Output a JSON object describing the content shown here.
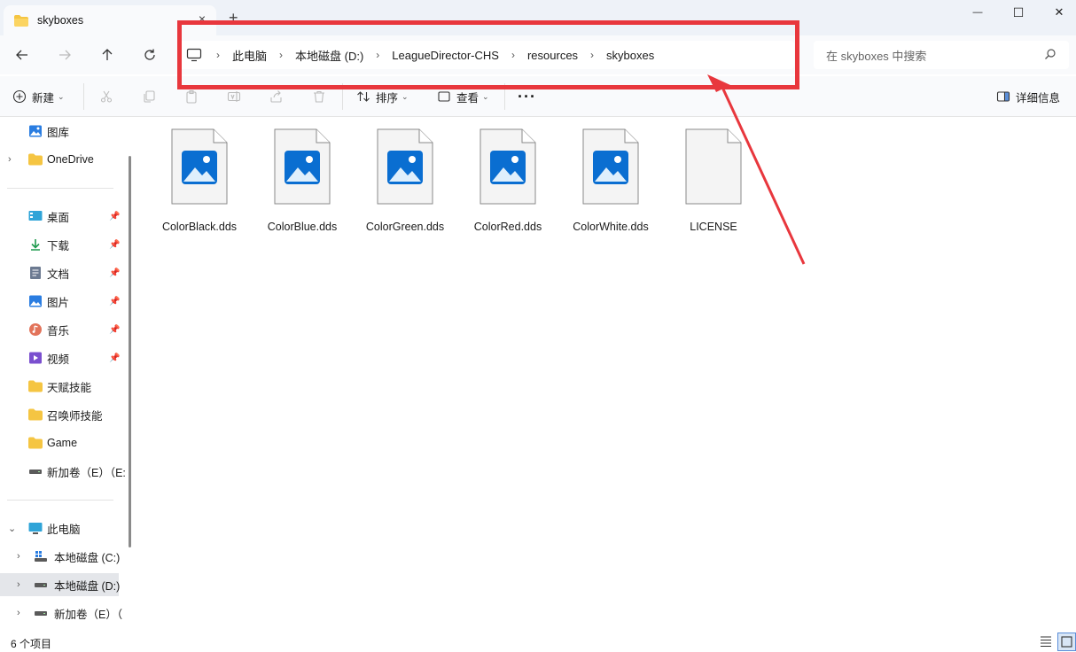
{
  "window": {
    "tab_title": "skyboxes",
    "tab_close": "×",
    "new_tab": "+",
    "controls": {
      "minimize": "—",
      "maximize": "☐",
      "close": "✕"
    }
  },
  "address_bar": {
    "breadcrumbs": [
      "此电脑",
      "本地磁盘 (D:)",
      "LeagueDirector-CHS",
      "resources",
      "skyboxes"
    ],
    "separator": "›"
  },
  "search": {
    "placeholder": "在 skyboxes 中搜索"
  },
  "command_bar": {
    "new_label": "新建",
    "sort_label": "排序",
    "view_label": "查看",
    "more_label": "···",
    "details_label": "详细信息"
  },
  "sidebar": {
    "gallery": "图库",
    "onedrive": "OneDrive",
    "quick_access": [
      {
        "label": "桌面",
        "icon": "desktop-icon",
        "pinned": true
      },
      {
        "label": "下载",
        "icon": "download-icon",
        "pinned": true
      },
      {
        "label": "文档",
        "icon": "document-icon",
        "pinned": true
      },
      {
        "label": "图片",
        "icon": "pictures-icon",
        "pinned": true
      },
      {
        "label": "音乐",
        "icon": "music-icon",
        "pinned": true
      },
      {
        "label": "视频",
        "icon": "video-icon",
        "pinned": true
      },
      {
        "label": "天赋技能",
        "icon": "folder-icon",
        "pinned": false
      },
      {
        "label": "召唤师技能",
        "icon": "folder-icon",
        "pinned": false
      },
      {
        "label": "Game",
        "icon": "folder-icon",
        "pinned": false
      },
      {
        "label": "新加卷（E）（E:",
        "icon": "drive-icon",
        "pinned": false
      }
    ],
    "this_pc": "此电脑",
    "drives": [
      {
        "label": "本地磁盘 (C:)",
        "icon": "windows-drive-icon",
        "selected": false
      },
      {
        "label": "本地磁盘 (D:)",
        "icon": "drive-icon",
        "selected": true
      },
      {
        "label": "新加卷（E）（",
        "icon": "drive-icon",
        "selected": false
      }
    ]
  },
  "files": [
    {
      "name": "ColorBlack.dds",
      "type": "image"
    },
    {
      "name": "ColorBlue.dds",
      "type": "image"
    },
    {
      "name": "ColorGreen.dds",
      "type": "image"
    },
    {
      "name": "ColorRed.dds",
      "type": "image"
    },
    {
      "name": "ColorWhite.dds",
      "type": "image"
    },
    {
      "name": "LICENSE",
      "type": "generic"
    }
  ],
  "status": {
    "item_count": "6 个项目"
  },
  "colors": {
    "annotation_red": "#e8373d",
    "accent_blue": "#0a6ed1",
    "folder_yellow": "#f5c542"
  }
}
